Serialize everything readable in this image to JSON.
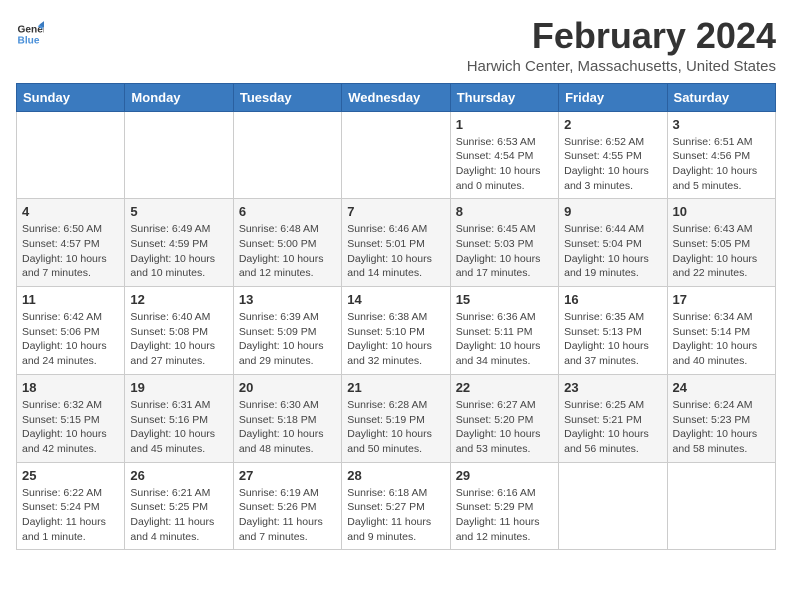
{
  "logo": {
    "text1": "General",
    "text2": "Blue"
  },
  "title": "February 2024",
  "location": "Harwich Center, Massachusetts, United States",
  "days_of_week": [
    "Sunday",
    "Monday",
    "Tuesday",
    "Wednesday",
    "Thursday",
    "Friday",
    "Saturday"
  ],
  "weeks": [
    [
      {
        "day": "",
        "info": ""
      },
      {
        "day": "",
        "info": ""
      },
      {
        "day": "",
        "info": ""
      },
      {
        "day": "",
        "info": ""
      },
      {
        "day": "1",
        "info": "Sunrise: 6:53 AM\nSunset: 4:54 PM\nDaylight: 10 hours\nand 0 minutes."
      },
      {
        "day": "2",
        "info": "Sunrise: 6:52 AM\nSunset: 4:55 PM\nDaylight: 10 hours\nand 3 minutes."
      },
      {
        "day": "3",
        "info": "Sunrise: 6:51 AM\nSunset: 4:56 PM\nDaylight: 10 hours\nand 5 minutes."
      }
    ],
    [
      {
        "day": "4",
        "info": "Sunrise: 6:50 AM\nSunset: 4:57 PM\nDaylight: 10 hours\nand 7 minutes."
      },
      {
        "day": "5",
        "info": "Sunrise: 6:49 AM\nSunset: 4:59 PM\nDaylight: 10 hours\nand 10 minutes."
      },
      {
        "day": "6",
        "info": "Sunrise: 6:48 AM\nSunset: 5:00 PM\nDaylight: 10 hours\nand 12 minutes."
      },
      {
        "day": "7",
        "info": "Sunrise: 6:46 AM\nSunset: 5:01 PM\nDaylight: 10 hours\nand 14 minutes."
      },
      {
        "day": "8",
        "info": "Sunrise: 6:45 AM\nSunset: 5:03 PM\nDaylight: 10 hours\nand 17 minutes."
      },
      {
        "day": "9",
        "info": "Sunrise: 6:44 AM\nSunset: 5:04 PM\nDaylight: 10 hours\nand 19 minutes."
      },
      {
        "day": "10",
        "info": "Sunrise: 6:43 AM\nSunset: 5:05 PM\nDaylight: 10 hours\nand 22 minutes."
      }
    ],
    [
      {
        "day": "11",
        "info": "Sunrise: 6:42 AM\nSunset: 5:06 PM\nDaylight: 10 hours\nand 24 minutes."
      },
      {
        "day": "12",
        "info": "Sunrise: 6:40 AM\nSunset: 5:08 PM\nDaylight: 10 hours\nand 27 minutes."
      },
      {
        "day": "13",
        "info": "Sunrise: 6:39 AM\nSunset: 5:09 PM\nDaylight: 10 hours\nand 29 minutes."
      },
      {
        "day": "14",
        "info": "Sunrise: 6:38 AM\nSunset: 5:10 PM\nDaylight: 10 hours\nand 32 minutes."
      },
      {
        "day": "15",
        "info": "Sunrise: 6:36 AM\nSunset: 5:11 PM\nDaylight: 10 hours\nand 34 minutes."
      },
      {
        "day": "16",
        "info": "Sunrise: 6:35 AM\nSunset: 5:13 PM\nDaylight: 10 hours\nand 37 minutes."
      },
      {
        "day": "17",
        "info": "Sunrise: 6:34 AM\nSunset: 5:14 PM\nDaylight: 10 hours\nand 40 minutes."
      }
    ],
    [
      {
        "day": "18",
        "info": "Sunrise: 6:32 AM\nSunset: 5:15 PM\nDaylight: 10 hours\nand 42 minutes."
      },
      {
        "day": "19",
        "info": "Sunrise: 6:31 AM\nSunset: 5:16 PM\nDaylight: 10 hours\nand 45 minutes."
      },
      {
        "day": "20",
        "info": "Sunrise: 6:30 AM\nSunset: 5:18 PM\nDaylight: 10 hours\nand 48 minutes."
      },
      {
        "day": "21",
        "info": "Sunrise: 6:28 AM\nSunset: 5:19 PM\nDaylight: 10 hours\nand 50 minutes."
      },
      {
        "day": "22",
        "info": "Sunrise: 6:27 AM\nSunset: 5:20 PM\nDaylight: 10 hours\nand 53 minutes."
      },
      {
        "day": "23",
        "info": "Sunrise: 6:25 AM\nSunset: 5:21 PM\nDaylight: 10 hours\nand 56 minutes."
      },
      {
        "day": "24",
        "info": "Sunrise: 6:24 AM\nSunset: 5:23 PM\nDaylight: 10 hours\nand 58 minutes."
      }
    ],
    [
      {
        "day": "25",
        "info": "Sunrise: 6:22 AM\nSunset: 5:24 PM\nDaylight: 11 hours\nand 1 minute."
      },
      {
        "day": "26",
        "info": "Sunrise: 6:21 AM\nSunset: 5:25 PM\nDaylight: 11 hours\nand 4 minutes."
      },
      {
        "day": "27",
        "info": "Sunrise: 6:19 AM\nSunset: 5:26 PM\nDaylight: 11 hours\nand 7 minutes."
      },
      {
        "day": "28",
        "info": "Sunrise: 6:18 AM\nSunset: 5:27 PM\nDaylight: 11 hours\nand 9 minutes."
      },
      {
        "day": "29",
        "info": "Sunrise: 6:16 AM\nSunset: 5:29 PM\nDaylight: 11 hours\nand 12 minutes."
      },
      {
        "day": "",
        "info": ""
      },
      {
        "day": "",
        "info": ""
      }
    ]
  ]
}
